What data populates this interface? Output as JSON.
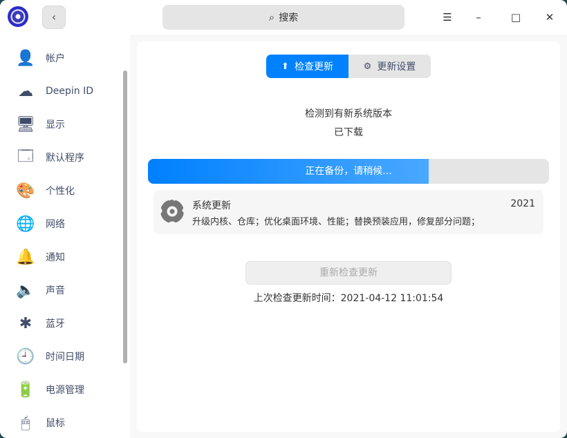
{
  "titlebar": {
    "back_icon": "‹",
    "search_placeholder": "搜索",
    "menu_icon": "☰",
    "min_icon": "–",
    "max_icon": "□",
    "close_icon": "✕"
  },
  "sidebar": {
    "items": [
      {
        "label": "帐户",
        "icon": "👤"
      },
      {
        "label": "Deepin ID",
        "icon": "☁"
      },
      {
        "label": "显示",
        "icon": "🖥"
      },
      {
        "label": "默认程序",
        "icon": "🗔"
      },
      {
        "label": "个性化",
        "icon": "🎨"
      },
      {
        "label": "网络",
        "icon": "🌐"
      },
      {
        "label": "通知",
        "icon": "🔔"
      },
      {
        "label": "声音",
        "icon": "🔈"
      },
      {
        "label": "蓝牙",
        "icon": "✱"
      },
      {
        "label": "时间日期",
        "icon": "🕘"
      },
      {
        "label": "电源管理",
        "icon": "🔋"
      },
      {
        "label": "鼠标",
        "icon": "🖱"
      }
    ]
  },
  "main": {
    "tabs": [
      {
        "label": "检查更新",
        "active": true
      },
      {
        "label": "更新设置",
        "active": false
      }
    ],
    "status": "检测到有新系统版本",
    "substatus": "已下载",
    "progress": {
      "label": "正在备份，请稍候...",
      "percent": 70
    },
    "update": {
      "name": "系统更新",
      "description": "升级内核、仓库；优化桌面环境、性能；替换预装应用，修复部分问题；",
      "version": "2021"
    },
    "recheck_label": "重新检查更新",
    "last_check": "上次检查更新时间：2021-04-12 11:01:54"
  }
}
